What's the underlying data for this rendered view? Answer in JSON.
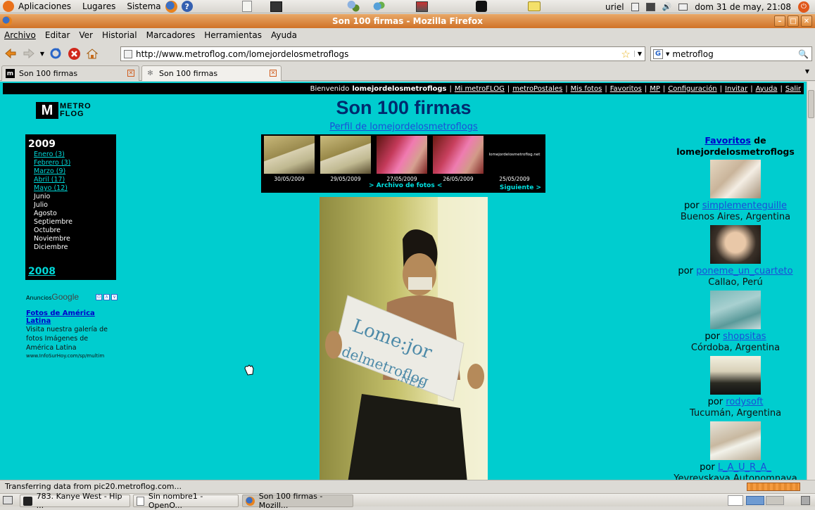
{
  "topbar": {
    "menu": [
      "Aplicaciones",
      "Lugares",
      "Sistema"
    ],
    "user": "uriel",
    "clock": "dom 31 de may, 21:08"
  },
  "window": {
    "title": "Son 100 firmas - Mozilla Firefox"
  },
  "menubar": [
    "Archivo",
    "Editar",
    "Ver",
    "Historial",
    "Marcadores",
    "Herramientas",
    "Ayuda"
  ],
  "nav": {
    "url": "http://www.metroflog.com/lomejordelosmetroflogs",
    "search": "metroflog"
  },
  "tabs": [
    {
      "label": "Son 100 firmas"
    },
    {
      "label": "Son 100 firmas"
    }
  ],
  "page": {
    "bar": {
      "welcome_prefix": "Bienvenido",
      "user": "lomejordelosmetroflogs",
      "links": [
        "Mi metroFLOG",
        "metroPostales",
        "Mis fotos",
        "Favoritos",
        "MP",
        "Configuración",
        "Invitar",
        "Ayuda",
        "Salir"
      ]
    },
    "logo": {
      "mark": "M",
      "line1": "METRO",
      "line2": "FLOG"
    },
    "title": "Son 100 firmas",
    "profile_link": "Perfil de lomejordelosmetroflogs",
    "archive": {
      "year": "2009",
      "months": [
        {
          "label": "Enero (3)",
          "link": true
        },
        {
          "label": "Febrero (3)",
          "link": true
        },
        {
          "label": "Marzo (9)",
          "link": true
        },
        {
          "label": "Abril (17)",
          "link": true
        },
        {
          "label": "Mayo (12)",
          "link": true
        },
        {
          "label": "Junio",
          "link": false
        },
        {
          "label": "Julio",
          "link": false
        },
        {
          "label": "Agosto",
          "link": false
        },
        {
          "label": "Septiembre",
          "link": false
        },
        {
          "label": "Octubre",
          "link": false
        },
        {
          "label": "Noviembre",
          "link": false
        },
        {
          "label": "Diciembre",
          "link": false
        }
      ],
      "prev_year": "2008"
    },
    "ads": {
      "label": "Anuncios",
      "brand": "Google",
      "title": "Fotos de América Latina",
      "text": "Visita nuestra galería de fotos Imágenes de América Latina",
      "url": "www.InfoSurHoy.com/sp/multim"
    },
    "photo_strip": {
      "dates": [
        "30/05/2009",
        "29/05/2009",
        "27/05/2009",
        "26/05/2009",
        "25/05/2009"
      ],
      "last_thumb_text": "lomejordelosmetroflog.net",
      "archive_link": "> Archivo de fotos <",
      "next": "Siguiente >"
    },
    "main_photo": {
      "sign_line1": "Lome:jor",
      "sign_line2": "delmetroflog",
      "sign_line3": ".NET"
    },
    "favorites": {
      "title_link": "Favoritos",
      "title_rest": "de",
      "owner": "lomejordelosmetroflogs",
      "by": "por",
      "items": [
        {
          "user": "simplementeguille",
          "location": "Buenos Aires, Argentina"
        },
        {
          "user": "poneme_un_cuarteto",
          "location": "Callao, Perú"
        },
        {
          "user": "shopsitas",
          "location": "Córdoba, Argentina"
        },
        {
          "user": "rodysoft",
          "location": "Tucumán, Argentina"
        },
        {
          "user": "L_A_U_R_A_",
          "location": "Yevreyskaya Autonomnaya"
        }
      ]
    }
  },
  "status": "Transferring data from pic20.metroflog.com...",
  "taskbar": [
    {
      "label": "783. Kanye West - Hip ..."
    },
    {
      "label": "Sin nombre1 - OpenO..."
    },
    {
      "label": "Son 100 firmas - Mozill..."
    }
  ]
}
